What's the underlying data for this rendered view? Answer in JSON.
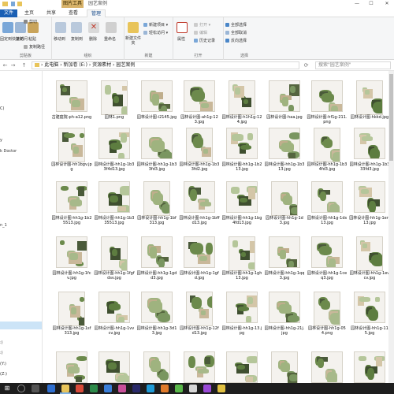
{
  "titlebar": {
    "context_tab": "图片工具",
    "title": "园艺案例",
    "min": "—",
    "max": "☐",
    "close": "✕"
  },
  "tabs": [
    "文件",
    "主页",
    "共享",
    "查看",
    "管理"
  ],
  "ribbon": {
    "clipboard": {
      "label": "剪贴板",
      "pin": "固定到快速访问",
      "copy": "复制",
      "paste": "粘贴",
      "cut": "剪切",
      "copy_path": "复制路径",
      "paste_shortcut": "粘贴快捷方式"
    },
    "organize": {
      "label": "组织",
      "move_to": "移动到",
      "copy_to": "复制到",
      "delete": "删除",
      "rename": "重命名"
    },
    "new": {
      "label": "新建",
      "new_folder": "新建文件夹",
      "new_item": "新建项目 ▾",
      "easy_access": "轻松访问 ▾"
    },
    "open": {
      "label": "打开",
      "properties": "属性",
      "open": "打开 ▾",
      "edit": "编辑",
      "history": "历史记录"
    },
    "select": {
      "label": "选择",
      "select_all": "全部选择",
      "select_none": "全部取消",
      "invert": "反向选择"
    }
  },
  "address": {
    "back": "←",
    "forward": "→",
    "up_arrow": "↑",
    "path": "› 此电脑 › 新加卷 (E:) › 资源素材 › 园艺案例",
    "search_placeholder": "搜索\"园艺案例\""
  },
  "sidebar": {
    "items": [
      "",
      "",
      "",
      "C)",
      "",
      "",
      "y",
      "k Doctor",
      "",
      "",
      "",
      "",
      "",
      "",
      "n_1",
      "",
      "",
      "",
      "",
      "",
      "",
      "",
      "",
      "",
      "",
      ":)",
      ":)",
      "(Y:)",
      "(Z:)"
    ]
  },
  "files": [
    [
      "古建庭院-ph-a12.png",
      "园林1.png",
      "园林设计图-i2145.jpg",
      "园林设计图-ah1g-123.jpg",
      "园林设计图-h1h1g-124.jpg",
      "园林设计图-haa.jpg",
      "园林设计图-hf1g-211.png",
      "园林设计图-hkkd.jpg"
    ],
    [
      "园林设计图-hh1bgv.jpg",
      "园林设计图-hh1g-1b33f4d13.jpg",
      "园林设计图-hh1g-1b33fd3.jpg",
      "园林设计图-hh1g-1b33fd2.jpg",
      "园林设计图-hh1g-1b213.jpg",
      "园林设计图-hh1g-1b313.jpg",
      "园林设计图-hh1g-1b34fd3.jpg",
      "园林设计图-hh1g-1b333fd3.jpg"
    ],
    [
      "园林设计图-hh1g-1b25513.jpg",
      "园林设计图-hh1g-1b335513.jpg",
      "园林设计图-hh1g-1bf313.jpg",
      "园林设计图-hh1g-1bffd13.jpg",
      "园林设计图-hh1g-1bg4fd13.jpg",
      "园林设计图-hh1g-1d3.jpg",
      "园林设计图-hh1g-1ds13.jpg",
      "园林设计图-hh1g-1err13.jpg"
    ],
    [
      "园林设计图-hh1g-1fcv.jpg",
      "园林设计图-hh1g-1fgfdsv.jpg",
      "园林设计图-hh1g-1gdd3.jpg",
      "园林设计图-hh1g-1gfd.jpg",
      "园林设计图-hh1g-1gh13.jpg",
      "园林设计图-hh1g-1qq3.jpg",
      "园林设计图-hh1g-1ceq3.jpg",
      "园林设计图-hh1g-1evcv.jpg"
    ],
    [
      "园林设计图-hh1g-1sf313.jpg",
      "园林设计图-hh1g-1vvcv.jpg",
      "园林设计图-hh1g-3d13.jpg",
      "园林设计图-hh1g-12fd13.jpg",
      "园林设计图-hh1g-13.jpg",
      "园林设计图-hh1g-21j.jpg",
      "园林设计图-hh1g-054.png",
      "园林设计图-hh1g-115.jpg"
    ],
    [
      "",
      "",
      "",
      "",
      "",
      "",
      "",
      ""
    ]
  ]
}
